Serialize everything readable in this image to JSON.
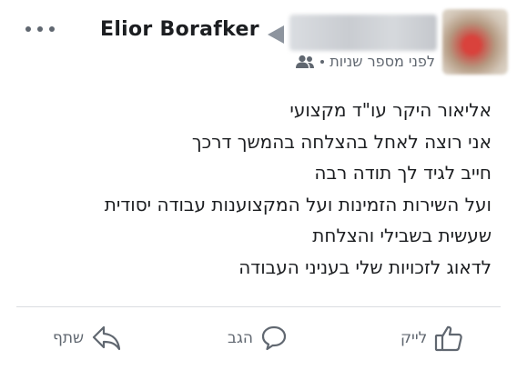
{
  "header": {
    "author_name": "Elior Borafker",
    "time_text": "לפני מספר שניות",
    "audience_icon": "friends-icon",
    "more_icon": "more-options-icon"
  },
  "post": {
    "lines": [
      "אליאור היקר  עו\"ד מקצועי",
      "אני רוצה לאחל בהצלחה בהמשך דרכך",
      "חייב לגיד לך תודה רבה",
      "ועל השירות הזמינות ועל המקצוענות עבודה יסודית",
      "שעשית בשבילי והצלחת",
      "לדאוג לזכויות שלי בעניני העבודה"
    ]
  },
  "actions": {
    "like_label": "לייק",
    "comment_label": "הגב",
    "share_label": "שתף"
  },
  "colors": {
    "text": "#1c1e21",
    "secondary": "#606770",
    "divider": "#dadde1"
  }
}
